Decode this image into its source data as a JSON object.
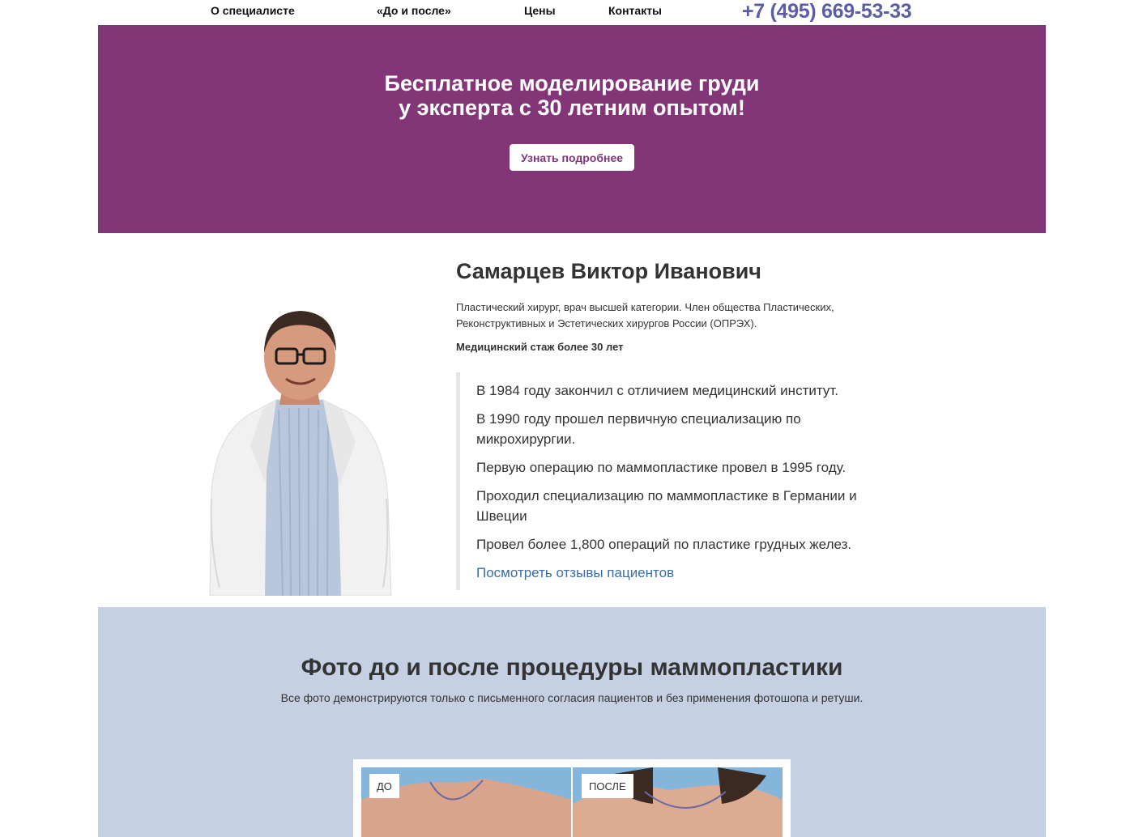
{
  "nav": {
    "items": [
      {
        "label": "О специалисте"
      },
      {
        "label": "«До и после»"
      },
      {
        "label": "Цены"
      },
      {
        "label": "Контакты"
      }
    ],
    "phone": "+7 (495) 669-53-33"
  },
  "hero": {
    "title_line1": "Бесплатное моделирование груди",
    "title_line2": "у эксперта с 30 летним опытом!",
    "button_label": "Узнать подробнее",
    "background_color": "#823678"
  },
  "doctor": {
    "name": "Самарцев Виктор Иванович",
    "description": "Пластический хирург, врач высшей категории. Член общества Пластических, Реконструктивных и Эстетических хирургов России (ОПРЭХ).",
    "experience": "Медицинский стаж более 30 лет",
    "bio": [
      "В 1984 году закончил с отличием медицинский институт.",
      "В 1990 году прошел первичную специализацию по микрохирургии.",
      "Первую операцию по маммопластике провел в 1995 году.",
      "Проходил специализацию по маммопластике в Германии и Швеции",
      "Провел более 1,800 операций по пластике грудных желез."
    ],
    "reviews_link": "Посмотреть отзывы пациентов"
  },
  "gallery": {
    "title": "Фото до и после процедуры маммопластики",
    "subtitle": "Все фото демонстрируются только с письменного согласия пациентов и без применения фотошопа и ретуши.",
    "before_label": "ДО",
    "after_label": "ПОСЛЕ",
    "background_color": "#c5d0e3"
  }
}
